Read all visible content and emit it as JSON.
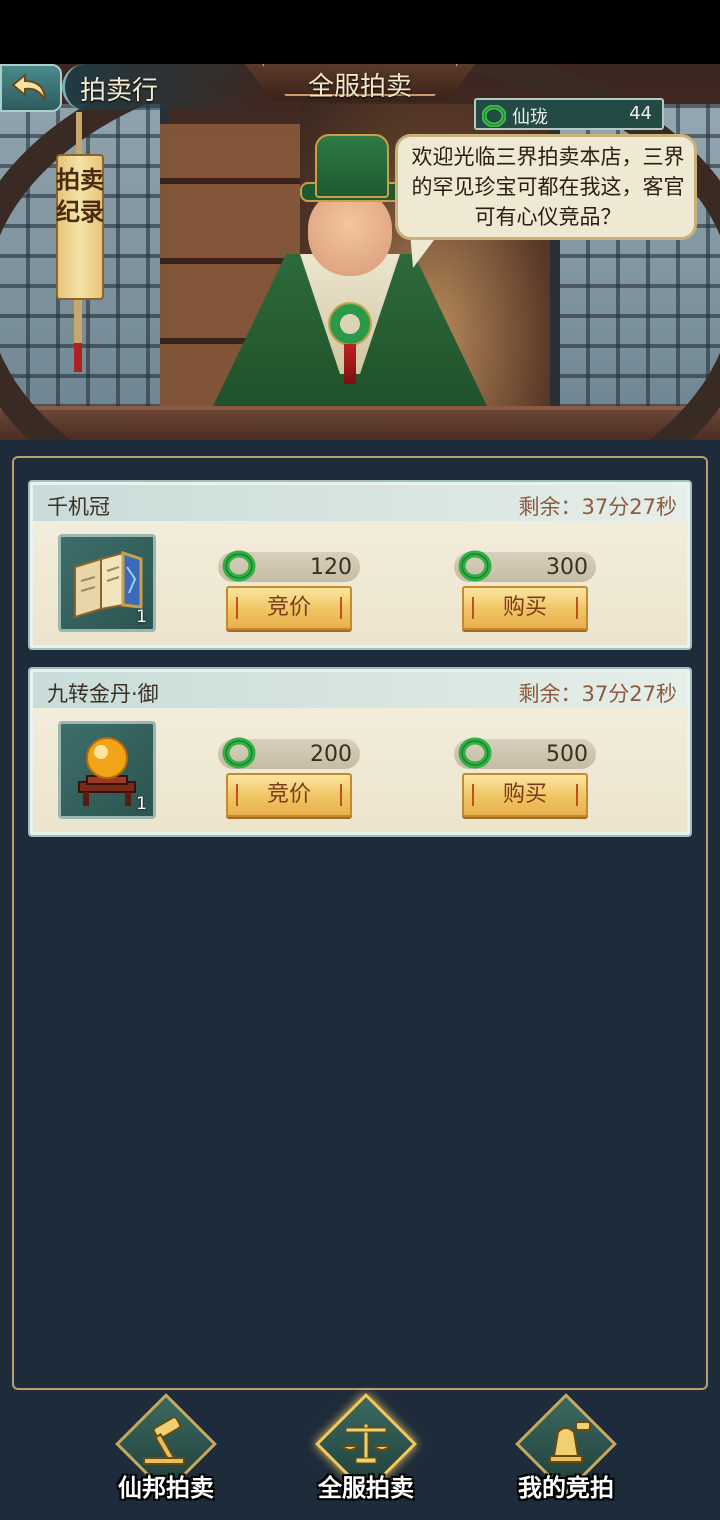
{
  "header": {
    "title": "拍卖行",
    "mode_banner": "全服拍卖",
    "currency": {
      "name": "仙珑",
      "amount": "44",
      "icon": "jade-ring-icon"
    },
    "speech": "欢迎光临三界拍卖本店，三界的罕见珍宝可都在我这，客官可有心仪竞品？",
    "record_button": "拍卖纪录"
  },
  "auctions": [
    {
      "name": "千机冠",
      "timer_label": "剩余：",
      "timer_value": "37分27秒",
      "item_icon": "scroll-map-icon",
      "count": "1",
      "bid_price": "120",
      "buy_price": "300",
      "bid_label": "竞价",
      "buy_label": "购买"
    },
    {
      "name": "九转金丹·御",
      "timer_label": "剩余：",
      "timer_value": "37分27秒",
      "item_icon": "golden-orb-icon",
      "count": "1",
      "bid_price": "200",
      "buy_price": "500",
      "bid_label": "竞价",
      "buy_label": "购买"
    }
  ],
  "bottom_nav": [
    {
      "label": "仙邦拍卖",
      "icon": "gavel-icon",
      "active": false
    },
    {
      "label": "全服拍卖",
      "icon": "scales-icon",
      "active": true
    },
    {
      "label": "我的竞拍",
      "icon": "bell-hammer-icon",
      "active": false
    }
  ],
  "colors": {
    "background": "#1e2b3b",
    "card": "#f4efe0",
    "button_gold": "#f0c462",
    "accent_green": "#2a9a4a",
    "timer_brown": "#8c5a3c"
  }
}
